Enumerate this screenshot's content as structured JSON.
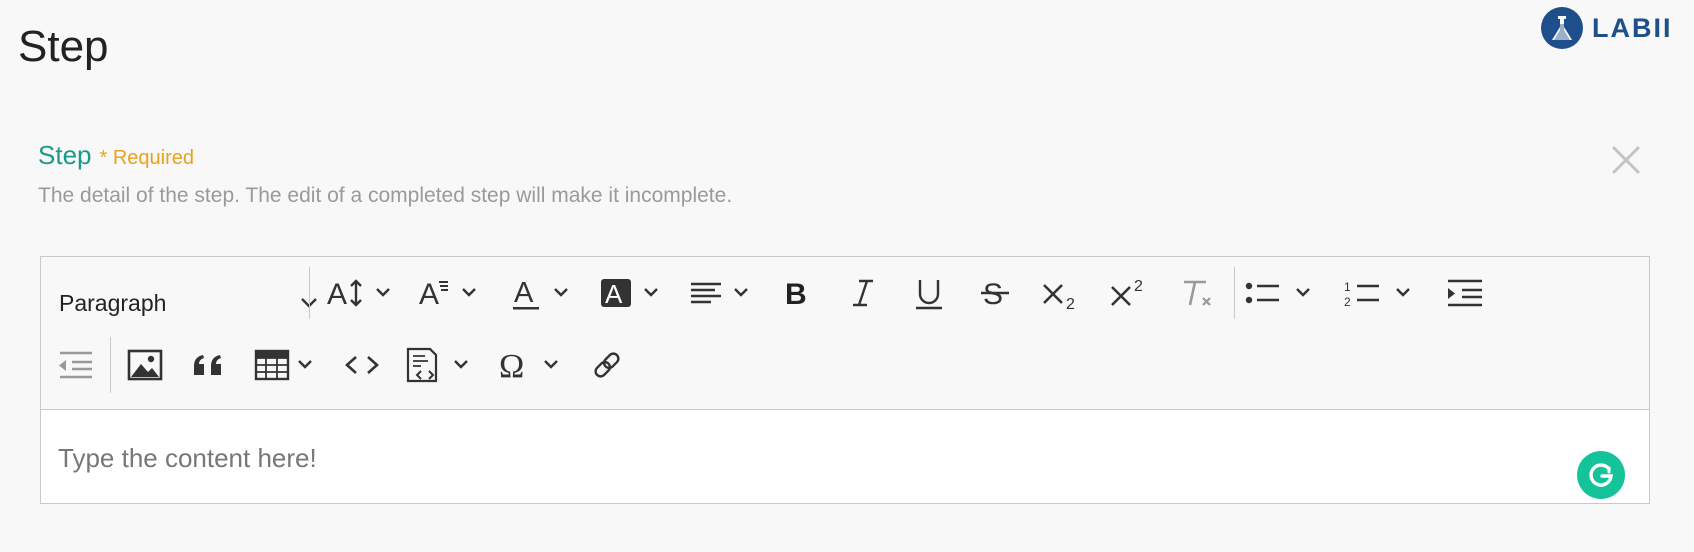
{
  "page": {
    "title": "Step"
  },
  "logo": {
    "text": "LABII"
  },
  "field": {
    "label": "Step",
    "required": "* Required",
    "help": "The detail of the step. The edit of a completed step will make it incomplete."
  },
  "editor": {
    "heading_select": "Paragraph",
    "placeholder": "Type the content here!"
  },
  "colors": {
    "accent": "#1b9a8a",
    "required": "#e8a21c",
    "brand": "#1e4f8a",
    "grammarly": "#15c39a"
  }
}
